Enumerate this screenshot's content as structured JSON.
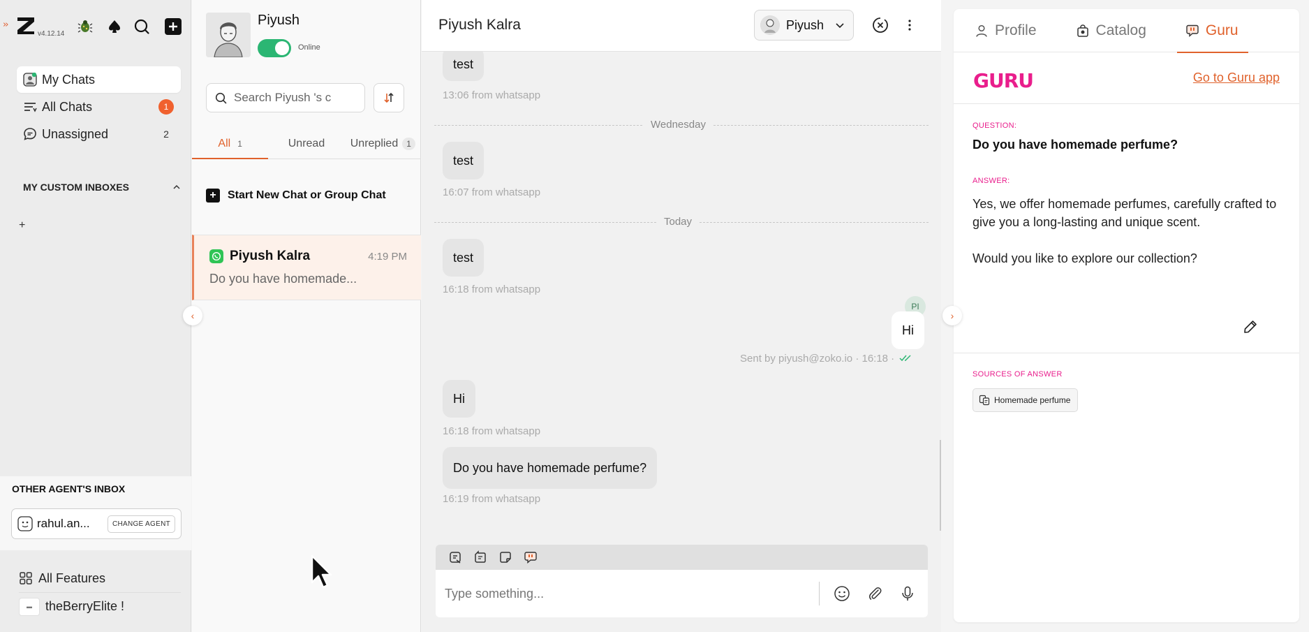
{
  "app": {
    "version": "v4.12.14"
  },
  "sidebar": {
    "items": [
      {
        "label": "My Chats",
        "badge": ""
      },
      {
        "label": "All Chats",
        "badge": "1"
      },
      {
        "label": "Unassigned",
        "badge": "2"
      }
    ],
    "custom_inboxes_title": "MY CUSTOM INBOXES",
    "add_symbol": "+",
    "other_agent_title": "OTHER AGENT'S INBOX",
    "other_agent_name": "rahul.an...",
    "change_agent_label": "CHANGE AGENT",
    "all_features_label": "All Features",
    "store_name": "theBerryElite !"
  },
  "chatlist": {
    "user_name": "Piyush",
    "status": "Online",
    "search_placeholder": "Search Piyush 's c",
    "tabs": [
      {
        "label": "All",
        "count": "1"
      },
      {
        "label": "Unread",
        "count": ""
      },
      {
        "label": "Unreplied",
        "count": "1"
      }
    ],
    "new_chat_label": "Start New Chat or Group Chat",
    "chats": [
      {
        "name": "Piyush Kalra",
        "time": "4:19 PM",
        "preview": "Do you have homemade..."
      }
    ]
  },
  "conversation": {
    "title": "Piyush Kalra",
    "assignee": "Piyush",
    "messages": [
      {
        "text": "test",
        "meta": "13:06 from whatsapp"
      },
      {
        "divider": "Wednesday"
      },
      {
        "text": "test",
        "meta": "16:07 from whatsapp"
      },
      {
        "divider": "Today"
      },
      {
        "text": "test",
        "meta": "16:18 from whatsapp"
      },
      {
        "text": "Hi",
        "meta": "Sent by piyush@zoko.io · 16:18 ·",
        "avatar": "PI"
      },
      {
        "text": "Hi",
        "meta": "16:18 from whatsapp"
      },
      {
        "text": "Do you have homemade perfume?",
        "meta": "16:19 from whatsapp"
      }
    ],
    "composer_placeholder": "Type something..."
  },
  "rightpanel": {
    "tabs": [
      "Profile",
      "Catalog",
      "Guru"
    ],
    "guru_logo": "GURU",
    "guru_link": "Go to Guru app",
    "question_label": "QUESTION:",
    "question": "Do you have homemade perfume?",
    "answer_label": "ANSWER:",
    "answer_p1": "Yes, we offer homemade perfumes, carefully crafted to give you a long-lasting and unique scent.",
    "answer_p2": "Would you like to explore our collection?",
    "sources_label": "SOURCES OF ANSWER",
    "source_chip": "Homemade perfume"
  },
  "colors": {
    "accent": "#e0622c",
    "guru_pink": "#e91e8c",
    "online_green": "#2bb673",
    "whatsapp_green": "#2fc455"
  }
}
